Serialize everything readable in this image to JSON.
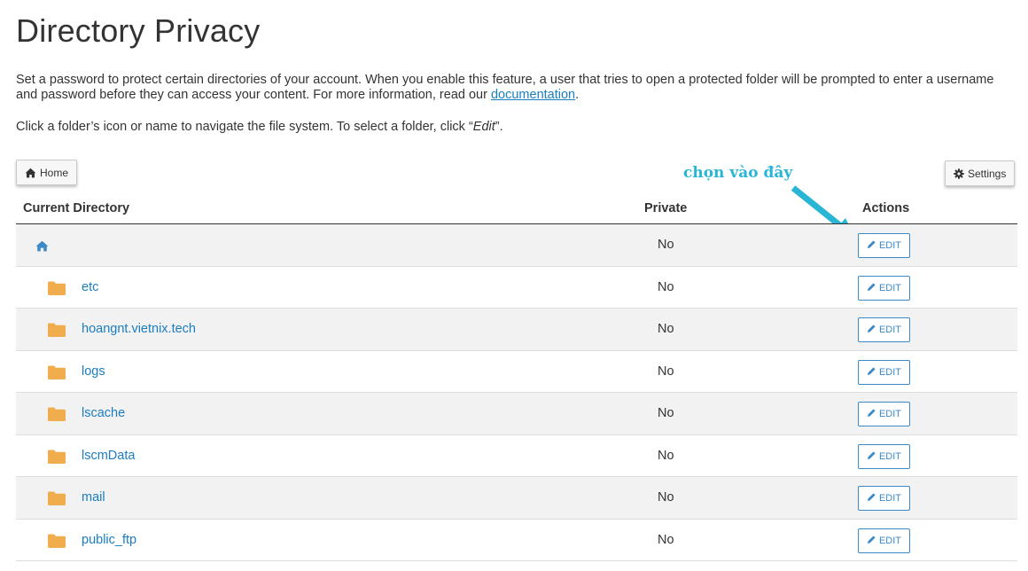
{
  "page": {
    "title": "Directory Privacy",
    "description_before_link": "Set a password to protect certain directories of your account. When you enable this feature, a user that tries to open a protected folder will be prompted to enter a username and password before they can access your content. For more information, read our ",
    "description_link": "documentation",
    "description_after_link": ".",
    "nav_hint_before": "Click a folder’s icon or name to navigate the file system. To select a folder, click “",
    "nav_hint_em": "Edit",
    "nav_hint_after": "”."
  },
  "toolbar": {
    "home_label": "Home",
    "settings_label": "Settings"
  },
  "annotation": {
    "text": "chọn vào đây",
    "color": "#29b6d6"
  },
  "table": {
    "headers": {
      "directory": "Current Directory",
      "private": "Private",
      "actions": "Actions"
    },
    "edit_label": "EDIT",
    "rows": [
      {
        "name": "",
        "icon": "home-icon",
        "private": "No"
      },
      {
        "name": "etc",
        "icon": "folder-icon",
        "private": "No"
      },
      {
        "name": "hoangnt.vietnix.tech",
        "icon": "folder-icon",
        "private": "No"
      },
      {
        "name": "logs",
        "icon": "folder-icon",
        "private": "No"
      },
      {
        "name": "lscache",
        "icon": "folder-icon",
        "private": "No"
      },
      {
        "name": "lscmData",
        "icon": "folder-icon",
        "private": "No"
      },
      {
        "name": "mail",
        "icon": "folder-icon",
        "private": "No"
      },
      {
        "name": "public_ftp",
        "icon": "folder-icon",
        "private": "No"
      }
    ]
  },
  "colors": {
    "link": "#1a7dc2",
    "folder": "#f0ad4e",
    "edit_border": "#3b8ac7",
    "row_alt": "#f2f2f2"
  }
}
